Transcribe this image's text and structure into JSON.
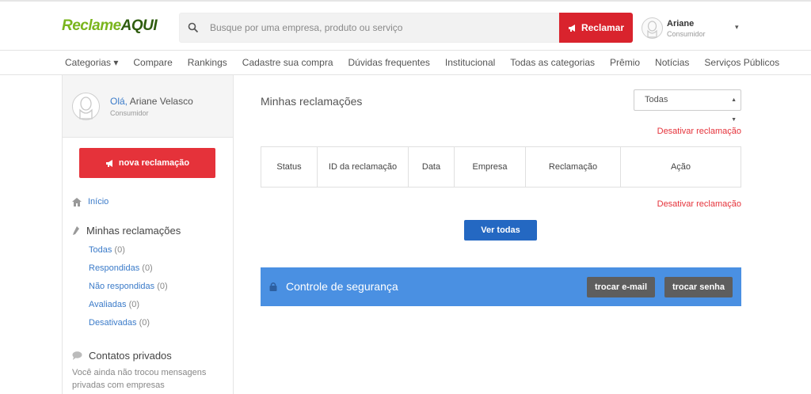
{
  "header": {
    "logo_part1": "Reclame",
    "logo_part2": "AQUI",
    "search_placeholder": "Busque por uma empresa, produto ou serviço",
    "reclamar_label": "Reclamar",
    "user_name": "Ariane",
    "user_role": "Consumidor"
  },
  "nav": {
    "items": [
      "Categorias",
      "Compare",
      "Rankings",
      "Cadastre sua compra",
      "Dúvidas frequentes",
      "Institucional",
      "Todas as categorias",
      "Prêmio",
      "Notícias",
      "Serviços Públicos"
    ]
  },
  "sidebar": {
    "greeting": "Olá,",
    "full_name": "Ariane Velasco",
    "role": "Consumidor",
    "nova_label": "nova reclamação",
    "inicio": "Início",
    "minhas": "Minhas reclamações",
    "sub": [
      {
        "label": "Todas",
        "count": "(0)"
      },
      {
        "label": "Respondidas",
        "count": "(0)"
      },
      {
        "label": "Não respondidas",
        "count": "(0)"
      },
      {
        "label": "Avaliadas",
        "count": "(0)"
      },
      {
        "label": "Desativadas",
        "count": "(0)"
      }
    ],
    "contatos": "Contatos privados",
    "contatos_text": "Você ainda não trocou mensagens privadas com empresas"
  },
  "main": {
    "title": "Minhas reclamações",
    "filter_value": "Todas",
    "deactivate_label": "Desativar reclamação",
    "columns": [
      "Status",
      "ID da reclamação",
      "Data",
      "Empresa",
      "Reclamação",
      "Ação"
    ],
    "ver_todas": "Ver todas",
    "security_title": "Controle de segurança",
    "trocar_email": "trocar e-mail",
    "trocar_senha": "trocar senha"
  },
  "colors": {
    "brand_green": "#7ab51d",
    "brand_red": "#d9232d",
    "link_blue": "#3b7bc9",
    "security_blue": "#4a90e2",
    "button_blue": "#2468c2"
  }
}
